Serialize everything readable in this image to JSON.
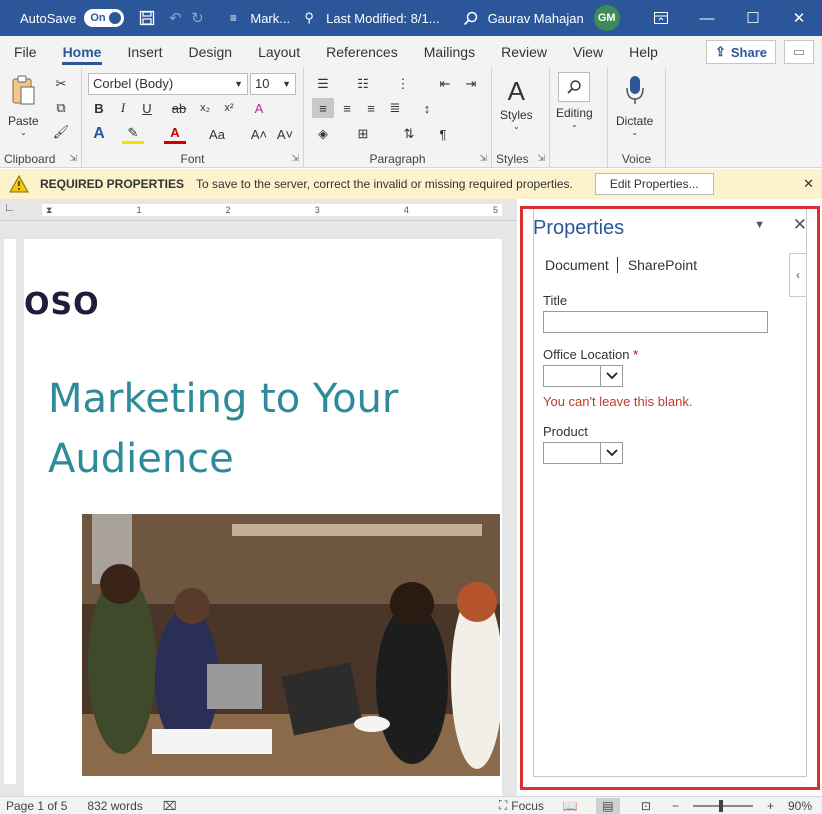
{
  "titlebar": {
    "autosave_label": "AutoSave",
    "autosave_state": "On",
    "doc_name": "Mark...",
    "modified": "Last Modified: 8/1...",
    "user_name": "Gaurav Mahajan",
    "user_initials": "GM"
  },
  "tabs": [
    "File",
    "Home",
    "Insert",
    "Design",
    "Layout",
    "References",
    "Mailings",
    "Review",
    "View",
    "Help"
  ],
  "share_label": "Share",
  "ribbon": {
    "paste_label": "Paste",
    "clipboard_label": "Clipboard",
    "font_name": "Corbel (Body)",
    "font_size": "10",
    "font_label": "Font",
    "paragraph_label": "Paragraph",
    "styles_btn": "Styles",
    "styles_label": "Styles",
    "editing_btn": "Editing",
    "dictate_btn": "Dictate",
    "voice_label": "Voice",
    "aa_label": "Aa"
  },
  "notification": {
    "header": "REQUIRED PROPERTIES",
    "message": "To save to the server, correct the invalid or missing required properties.",
    "button": "Edit Properties..."
  },
  "ruler_marks": [
    "1",
    "2",
    "3",
    "4",
    "5"
  ],
  "document": {
    "logo": "OSO",
    "title": "Marketing to Your Audience"
  },
  "properties": {
    "title": "Properties",
    "tab_document": "Document",
    "tab_sharepoint": "SharePoint",
    "field_title": "Title",
    "field_office": "Office Location",
    "required_mark": "*",
    "error": "You can't leave this blank.",
    "field_product": "Product"
  },
  "status": {
    "page": "Page 1 of 5",
    "words": "832 words",
    "focus": "Focus",
    "zoom": "90%"
  }
}
